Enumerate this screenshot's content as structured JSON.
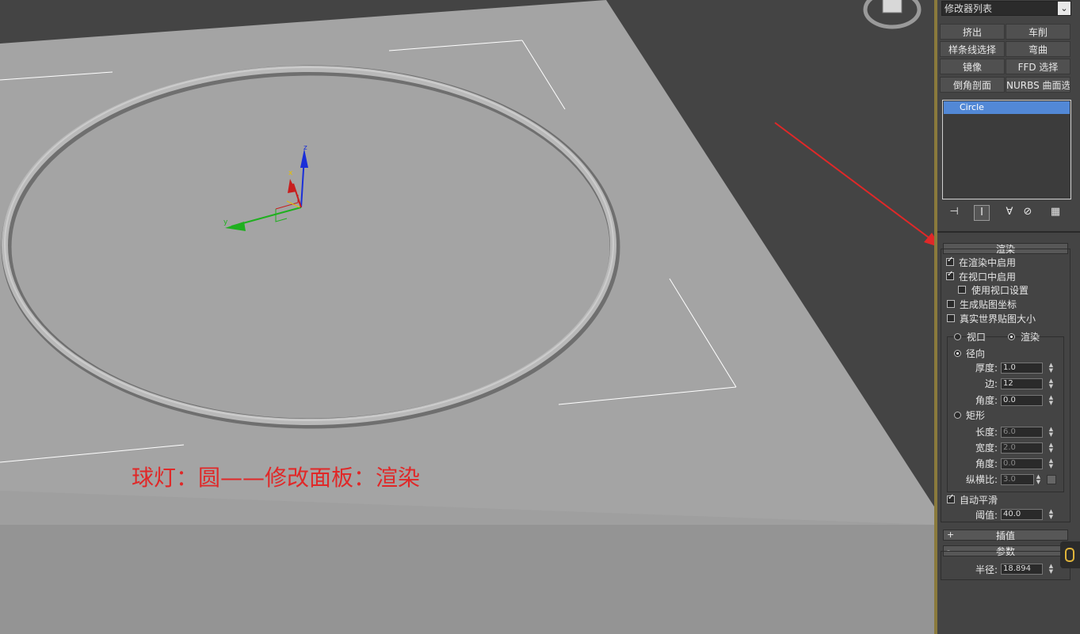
{
  "annotation": "球灯：圆——修改面板：渲染",
  "viewport": {
    "axis_labels": {
      "x": "x",
      "y": "y",
      "z": "z"
    },
    "colors": {
      "floor_top": "#a4a4a4",
      "floor_side": "#8e8e8e",
      "background": "#444444",
      "arrow": "#e02828"
    }
  },
  "panel": {
    "modifier_list": "修改器列表",
    "buttons": [
      "挤出",
      "车削",
      "样条线选择",
      "弯曲",
      "镜像",
      "FFD 选择",
      "倒角剖面",
      "NURBS 曲面选择"
    ],
    "stack_item": "Circle",
    "stack_icons": [
      "pin-stack-icon",
      "show-end-result-icon",
      "make-unique-icon",
      "remove-modifier-icon",
      "configure-modifier-sets-icon"
    ],
    "render": {
      "title": "渲染",
      "enable_in_renderer": "在渲染中启用",
      "enable_in_viewport": "在视口中启用",
      "use_viewport_settings": "使用视口设置",
      "generate_mapping_coords": "生成贴图坐标",
      "real_world_map_size": "真实世界贴图大小",
      "viewport_radio": "视口",
      "render_radio": "渲染",
      "radial": "径向",
      "thickness_label": "厚度:",
      "thickness": "1.0",
      "sides_label": "边:",
      "sides": "12",
      "angle_label": "角度:",
      "angle": "0.0",
      "rectangular": "矩形",
      "length_label": "长度:",
      "length": "6.0",
      "width_label": "宽度:",
      "width": "2.0",
      "rect_angle_label": "角度:",
      "rect_angle": "0.0",
      "aspect_label": "纵横比:",
      "aspect": "3.0",
      "auto_smooth": "自动平滑",
      "threshold_label": "阈值:",
      "threshold": "40.0"
    },
    "interpolation": {
      "title": "插值",
      "toggle": "+"
    },
    "parameters": {
      "title": "参数",
      "toggle": "-",
      "radius_label": "半径:",
      "radius": "18.894"
    }
  }
}
